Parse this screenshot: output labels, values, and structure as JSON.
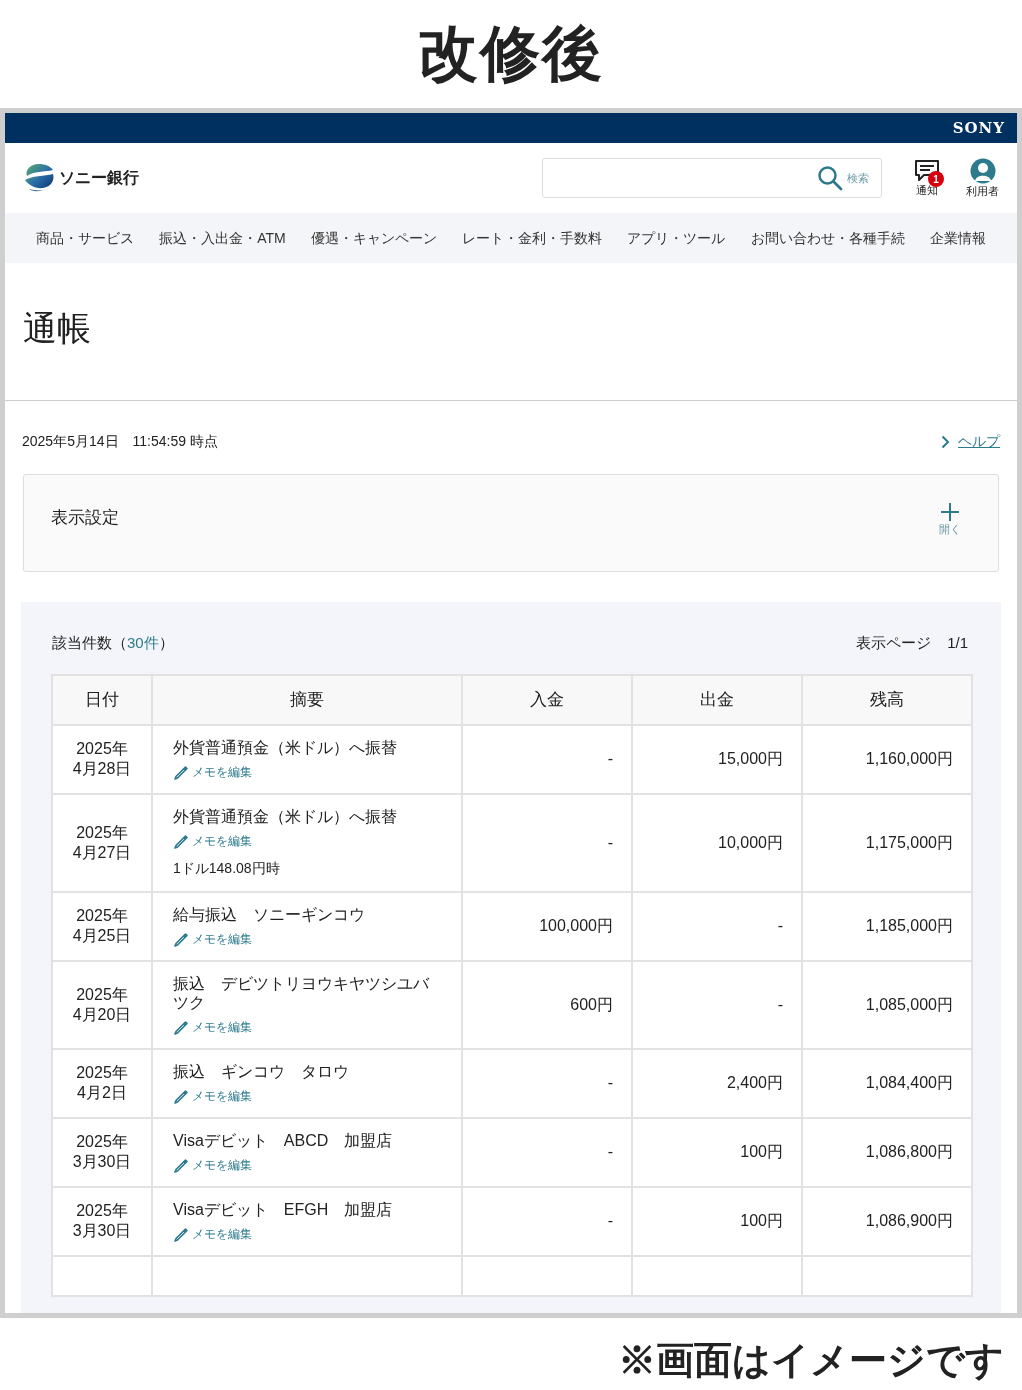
{
  "caption": "改修後",
  "brand_bar": {
    "brand": "SONY"
  },
  "header": {
    "bank_name": "ソニー銀行",
    "search": {
      "button": "検索"
    },
    "notifications": {
      "label": "通知",
      "badge": "1"
    },
    "user": {
      "label": "利用者"
    }
  },
  "nav": [
    "商品・サービス",
    "振込・入出金・ATM",
    "優遇・キャンペーン",
    "レート・金利・手数料",
    "アプリ・ツール",
    "お問い合わせ・各種手続",
    "企業情報"
  ],
  "page_title": "通帳",
  "timestamp": "2025年5月14日　11:54:59 時点",
  "help_link": "ヘルプ",
  "display_settings": {
    "title": "表示設定",
    "toggle": "開く",
    "expanded": false
  },
  "results": {
    "count_label": "該当件数（",
    "count": "30件",
    "count_end": "）",
    "page_label": "表示ページ",
    "page": "1/1"
  },
  "table": {
    "columns": [
      "日付",
      "摘要",
      "入金",
      "出金",
      "残高"
    ],
    "rows": [
      {
        "date": "2025年\n4月28日",
        "description": "外貨普通預金（米ドル）へ振替",
        "memo": "メモを編集",
        "deposit": "-",
        "withdrawal": "15,000円",
        "balance": "1,160,000円"
      },
      {
        "date": "2025年\n4月27日",
        "description": "外貨普通預金（米ドル）へ振替",
        "memo": "メモを編集",
        "note": "1ドル148.08円時",
        "deposit": "-",
        "withdrawal": "10,000円",
        "balance": "1,175,000円"
      },
      {
        "date": "2025年\n4月25日",
        "description": "給与振込　ソニーギンコウ",
        "memo": "メモを編集",
        "deposit": "100,000円",
        "withdrawal": "-",
        "balance": "1,185,000円"
      },
      {
        "date": "2025年\n4月20日",
        "description": "振込　デビツトリヨウキヤツシユバツク",
        "memo": "メモを編集",
        "deposit": "600円",
        "withdrawal": "-",
        "balance": "1,085,000円"
      },
      {
        "date": "2025年\n4月2日",
        "description": "振込　ギンコウ　タロウ",
        "memo": "メモを編集",
        "deposit": "-",
        "withdrawal": "2,400円",
        "balance": "1,084,400円"
      },
      {
        "date": "2025年\n3月30日",
        "description": "Visaデビット　ABCD　加盟店",
        "memo": "メモを編集",
        "deposit": "-",
        "withdrawal": "100円",
        "balance": "1,086,800円"
      },
      {
        "date": "2025年\n3月30日",
        "description": "Visaデビット　EFGH　加盟店",
        "memo": "メモを編集",
        "deposit": "-",
        "withdrawal": "100円",
        "balance": "1,086,900円"
      }
    ]
  },
  "footnote": "※画面はイメージです"
}
